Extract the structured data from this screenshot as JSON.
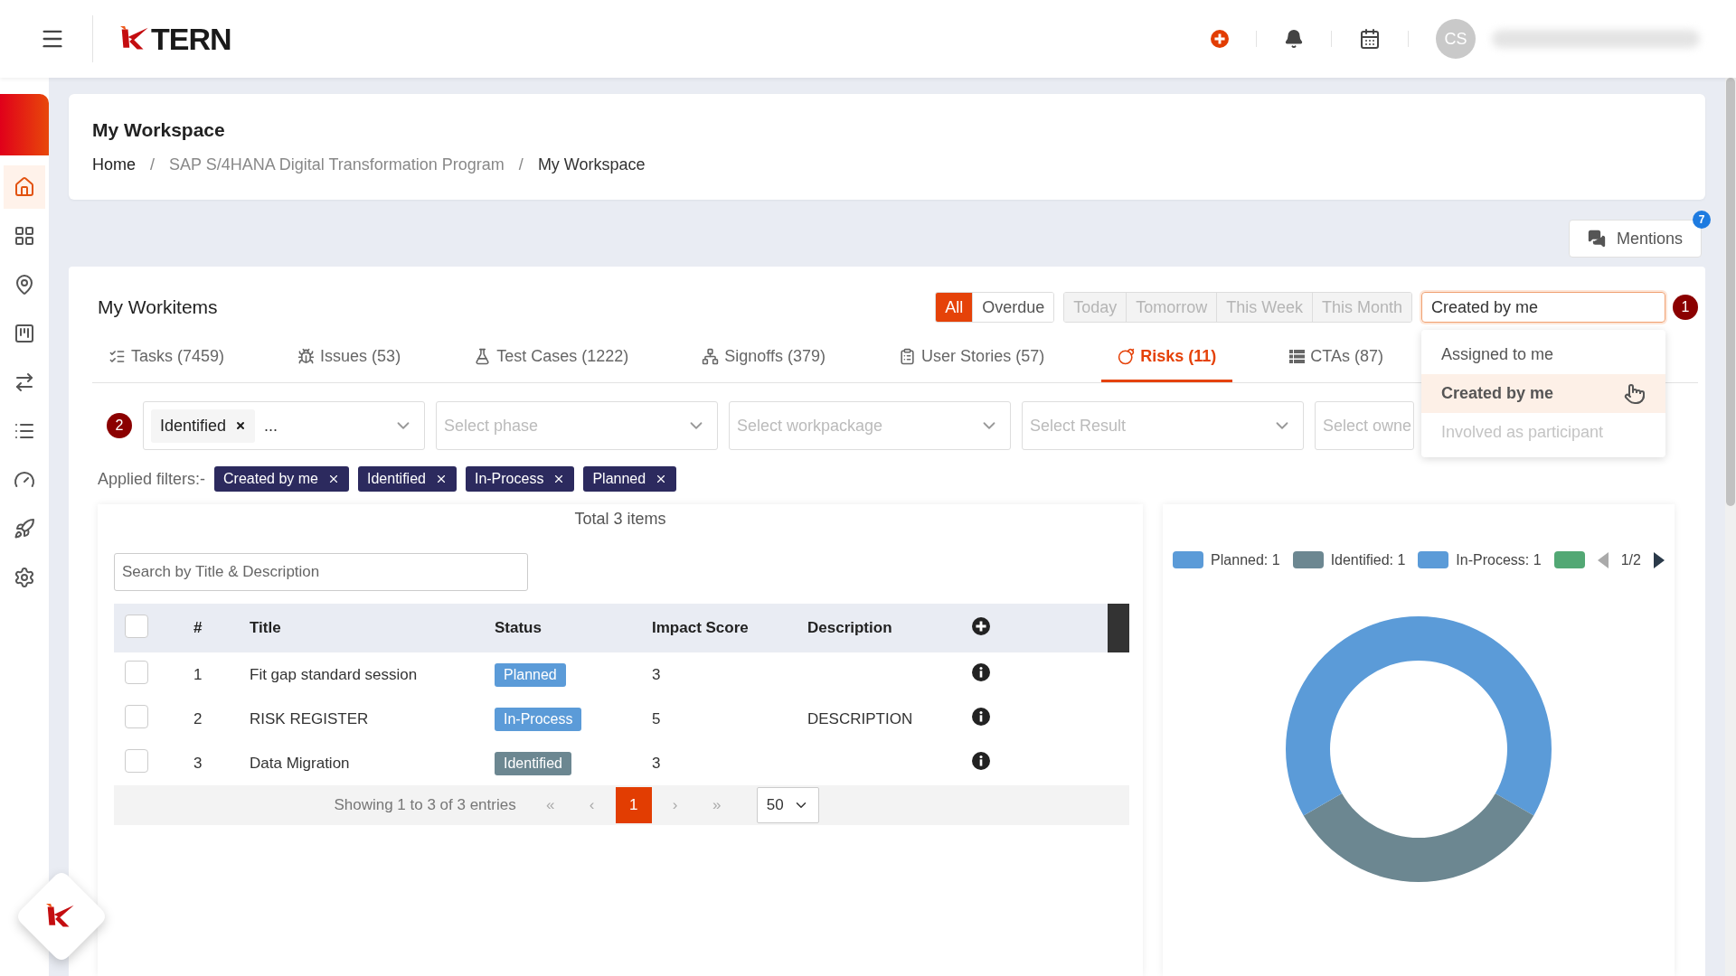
{
  "top_bar": {
    "logo_text": "TERN",
    "avatar_initials": "CS"
  },
  "sidebar": {
    "items": [
      {
        "kind": "home",
        "selected": true
      },
      {
        "kind": "grid",
        "selected": false
      },
      {
        "kind": "pin",
        "selected": false
      },
      {
        "kind": "board",
        "selected": false
      },
      {
        "kind": "arrows",
        "selected": false
      },
      {
        "kind": "list",
        "selected": false
      },
      {
        "kind": "gauge",
        "selected": false
      },
      {
        "kind": "rocket",
        "selected": false
      },
      {
        "kind": "settings",
        "selected": false
      }
    ]
  },
  "header": {
    "title": "My Workspace",
    "breadcrumb": [
      {
        "label": "Home",
        "kind": "link"
      },
      {
        "label": "/",
        "kind": "separator"
      },
      {
        "label": "SAP S/4HANA Digital Transformation Program",
        "kind": "muted"
      },
      {
        "label": "/",
        "kind": "separator"
      },
      {
        "label": "My Workspace",
        "kind": "current"
      }
    ]
  },
  "mentions": {
    "label": "Mentions",
    "count": "7"
  },
  "workitems": {
    "title": "My Workitems",
    "period_primary": [
      {
        "label": "All",
        "selected": true
      },
      {
        "label": "Overdue",
        "selected": false
      }
    ],
    "period_secondary": [
      {
        "label": "Today",
        "disabled": true
      },
      {
        "label": "Tomorrow",
        "disabled": true
      },
      {
        "label": "This Week",
        "disabled": true
      },
      {
        "label": "This Month",
        "disabled": true
      }
    ],
    "owner_filter": {
      "value": "Created by me",
      "badge": "1",
      "options": [
        {
          "label": "Assigned to me",
          "selected": false,
          "disabled": false
        },
        {
          "label": "Created by me",
          "selected": true,
          "disabled": false
        },
        {
          "label": "Involved as participant",
          "selected": false,
          "disabled": true
        }
      ]
    },
    "tabs": [
      {
        "label": "Tasks (7459)",
        "kind": "tasks",
        "selected": false
      },
      {
        "label": "Issues (53)",
        "kind": "issues",
        "selected": false
      },
      {
        "label": "Test Cases (1222)",
        "kind": "tests",
        "selected": false
      },
      {
        "label": "Signoffs (379)",
        "kind": "signoffs",
        "selected": false
      },
      {
        "label": "User Stories (57)",
        "kind": "stories",
        "selected": false
      },
      {
        "label": "Risks (11)",
        "kind": "risks",
        "selected": true
      },
      {
        "label": "CTAs (87)",
        "kind": "ctas",
        "selected": false
      }
    ],
    "filter_badge": "2",
    "filters": [
      {
        "chip": "Identified",
        "more": "..."
      },
      {
        "placeholder": "Select phase"
      },
      {
        "placeholder": "Select workpackage"
      },
      {
        "placeholder": "Select Result"
      },
      {
        "placeholder": "Select owne"
      }
    ],
    "applied_label": "Applied filters:-",
    "applied": [
      "Created by me",
      "Identified",
      "In-Process",
      "Planned"
    ],
    "total": "Total 3 items",
    "search": {
      "placeholder": "Search by Title & Description"
    },
    "table": {
      "header_checked": false,
      "columns": [
        "#",
        "Title",
        "Status",
        "Impact Score",
        "Description"
      ],
      "rows": [
        {
          "checked": false,
          "num": "1",
          "title": "Fit gap standard session",
          "status": "Planned",
          "color": "#5b9bd8",
          "impact": "3",
          "description": ""
        },
        {
          "checked": false,
          "num": "2",
          "title": "RISK REGISTER",
          "status": "In-Process",
          "color": "#5b9bd8",
          "impact": "5",
          "description": "DESCRIPTION"
        },
        {
          "checked": false,
          "num": "3",
          "title": "Data Migration",
          "status": "Identified",
          "color": "#6c8791",
          "impact": "3",
          "description": ""
        }
      ]
    },
    "pagination": {
      "summary": "Showing 1 to 3 of 3 entries",
      "first": "«",
      "prev": "‹",
      "pages": [
        {
          "label": "1",
          "selected": true
        }
      ],
      "next": "›",
      "last": "»",
      "page_size": "50"
    },
    "legend_colors": [
      {
        "color": "#5b9bd8"
      },
      {
        "color": "#6c8791"
      },
      {
        "color": "#5b9bd8"
      },
      {
        "color": "#52a874"
      }
    ],
    "legend_pager": "1/2",
    "chart_data": {
      "type": "donut",
      "categories": [
        "Planned: 1",
        "Identified: 1",
        "In-Process: 1"
      ],
      "series": [
        {
          "values": [
            1,
            1,
            1
          ]
        }
      ]
    }
  }
}
